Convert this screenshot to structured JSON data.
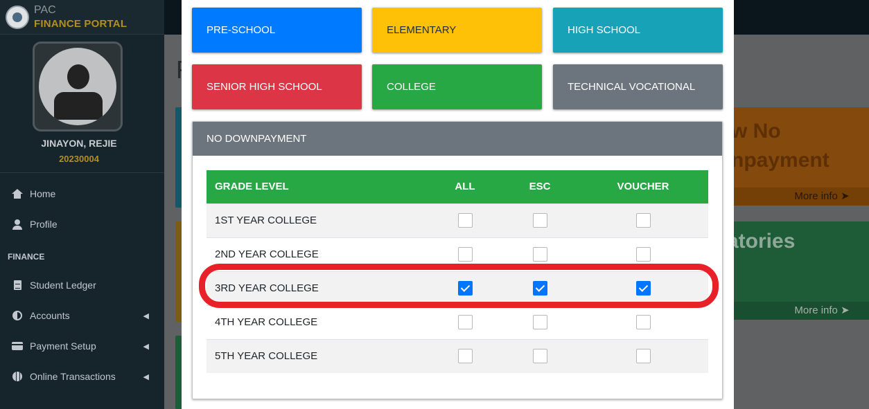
{
  "brand": {
    "name": "PAC",
    "subtitle": "FINANCE PORTAL"
  },
  "user": {
    "name": "JINAYON, REJIE",
    "id": "20230004"
  },
  "nav": {
    "home": "Home",
    "profile": "Profile",
    "section": "FINANCE",
    "student_ledger": "Student Ledger",
    "accounts": "Accounts",
    "payment_setup": "Payment Setup",
    "online_transactions": "Online Transactions"
  },
  "background": {
    "title_fragment": "F",
    "orange_card": {
      "line1": "w No",
      "line2": "npayment",
      "more": "More info"
    },
    "green_card": {
      "text": "atories",
      "more": "More info"
    }
  },
  "modal": {
    "levels": [
      {
        "label": "PRE-SCHOOL",
        "color": "#007bff"
      },
      {
        "label": "ELEMENTARY",
        "color": "#ffc107"
      },
      {
        "label": "HIGH SCHOOL",
        "color": "#17a2b8"
      },
      {
        "label": "SENIOR HIGH SCHOOL",
        "color": "#dc3545"
      },
      {
        "label": "COLLEGE",
        "color": "#28a745"
      },
      {
        "label": "TECHNICAL VOCATIONAL",
        "color": "#6c757d"
      }
    ],
    "card_title": "NO DOWNPAYMENT",
    "table": {
      "headers": [
        "GRADE LEVEL",
        "ALL",
        "ESC",
        "VOUCHER"
      ],
      "rows": [
        {
          "grade": "1ST YEAR COLLEGE",
          "all": false,
          "esc": false,
          "voucher": false
        },
        {
          "grade": "2ND YEAR COLLEGE",
          "all": false,
          "esc": false,
          "voucher": false
        },
        {
          "grade": "3RD YEAR COLLEGE",
          "all": true,
          "esc": true,
          "voucher": true
        },
        {
          "grade": "4TH YEAR COLLEGE",
          "all": false,
          "esc": false,
          "voucher": false
        },
        {
          "grade": "5TH YEAR COLLEGE",
          "all": false,
          "esc": false,
          "voucher": false
        }
      ]
    }
  }
}
